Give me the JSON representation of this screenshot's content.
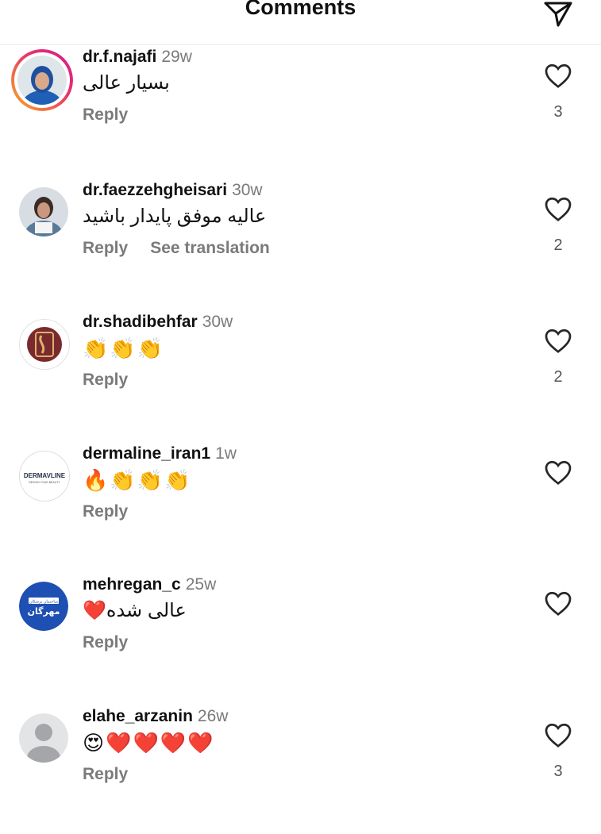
{
  "header": {
    "title": "Comments",
    "send_icon": "send-icon"
  },
  "comments": [
    {
      "username": "dr.f.najafi",
      "time": "29w",
      "text": "بسیار عالی",
      "actions": [
        "Reply"
      ],
      "likes": "3"
    },
    {
      "username": "dr.faezzehgheisari",
      "time": "30w",
      "text": "عالیه موفق پایدار باشید",
      "actions": [
        "Reply",
        "See translation"
      ],
      "likes": "2"
    },
    {
      "username": "dr.shadibehfar",
      "time": "30w",
      "text": "👏👏👏",
      "actions": [
        "Reply"
      ],
      "likes": "2"
    },
    {
      "username": "dermaline_iran1",
      "time": "1w",
      "text": "🔥👏👏👏",
      "actions": [
        "Reply"
      ],
      "likes": ""
    },
    {
      "username": "mehregan_c",
      "time": "25w",
      "text": "عالی شده❤️",
      "actions": [
        "Reply"
      ],
      "likes": ""
    },
    {
      "username": "elahe_arzanin",
      "time": "26w",
      "text": "😍❤️❤️❤️❤️",
      "actions": [
        "Reply"
      ],
      "likes": "3"
    }
  ],
  "avatars": {
    "dermaline_logo": "DERMAVLINE",
    "dermaline_tagline": "DESIGN YOUR BEAUTY",
    "mehregan_logo_top": "ساختمان پزشکان",
    "mehregan_logo_main": "مهرگان"
  },
  "colors": {
    "muted": "#7a7a7a",
    "heart_outline": "#262626",
    "story_ring_start": "#f9a825",
    "story_ring_end": "#d81b8c",
    "mehregan_blue": "#1e4fb3"
  }
}
